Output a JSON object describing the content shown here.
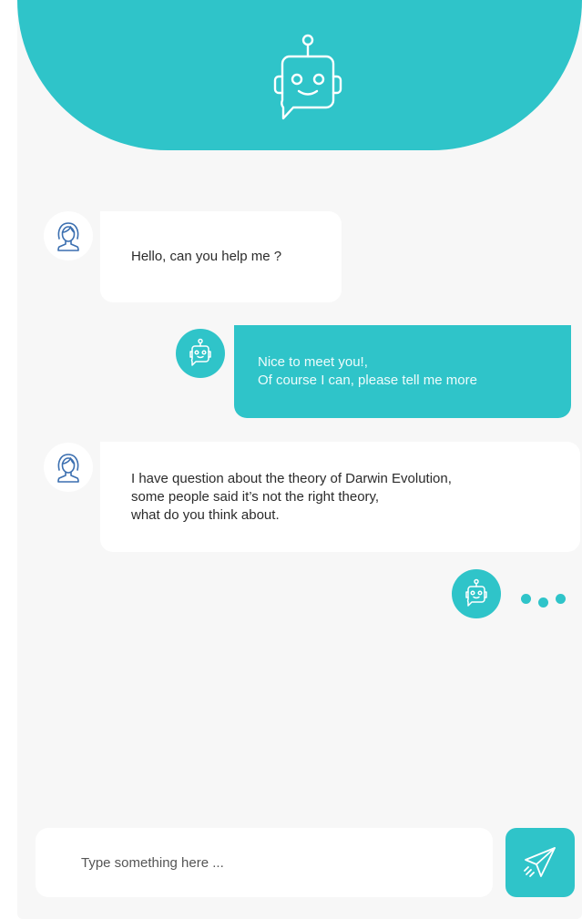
{
  "theme": {
    "accent": "#2fc4c9",
    "background": "#f7f7f7",
    "bubble_user": "#ffffff"
  },
  "header": {
    "icon": "robot-chat-icon"
  },
  "messages": [
    {
      "sender": "user",
      "avatar_icon": "woman-avatar-icon",
      "text": "Hello, can you help me ?"
    },
    {
      "sender": "bot",
      "avatar_icon": "robot-icon",
      "text": "Nice to meet you!,\nOf course I can, please tell me more"
    },
    {
      "sender": "user",
      "avatar_icon": "woman-avatar-icon",
      "text": "I have question about the theory of Darwin Evolution,\nsome people said it’s not the right theory,\nwhat do you think about."
    }
  ],
  "typing_indicator": {
    "sender": "bot",
    "avatar_icon": "robot-icon"
  },
  "composer": {
    "placeholder": "Type something here ...",
    "value": "",
    "send_icon": "paper-plane-icon"
  }
}
